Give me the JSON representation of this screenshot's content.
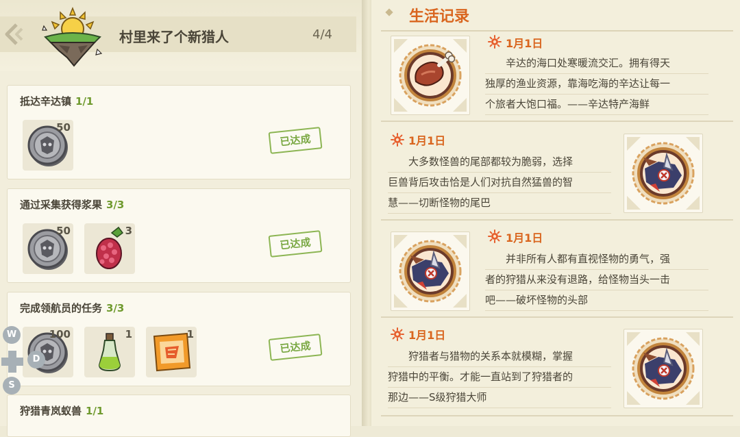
{
  "quest": {
    "title": "村里来了个新猎人",
    "progress": "4/4"
  },
  "tasks": [
    {
      "label": "抵达辛达镇",
      "count": "1/1",
      "status": "已达成",
      "rewards": [
        {
          "icon": "coin-icon",
          "qty": "50"
        }
      ]
    },
    {
      "label": "通过采集获得浆果",
      "count": "3/3",
      "status": "已达成",
      "rewards": [
        {
          "icon": "coin-icon",
          "qty": "50"
        },
        {
          "icon": "berry-icon",
          "qty": "3"
        }
      ]
    },
    {
      "label": "完成领航员的任务",
      "count": "3/3",
      "status": "已达成",
      "rewards": [
        {
          "icon": "coin-icon",
          "qty": "100"
        },
        {
          "icon": "potion-icon",
          "qty": "1"
        },
        {
          "icon": "map-scroll-icon",
          "qty": "1"
        }
      ]
    },
    {
      "label": "狩猎青岚蚁兽",
      "count": "1/1"
    }
  ],
  "controls": {
    "up": "W",
    "right": "D",
    "down": "S"
  },
  "log": {
    "title": "生活记录",
    "entries": [
      {
        "date": "1月1日",
        "icon": "meat-icon",
        "lines": [
          "辛达的海口处寒暖流交汇。拥有得天",
          "独厚的渔业资源，靠海吃海的辛达让每一",
          "个旅者大饱口福。——辛达特产海鲜"
        ]
      },
      {
        "date": "1月1日",
        "icon": "monster-tail-icon",
        "lines": [
          "大多数怪兽的尾部都较为脆弱，选择",
          "巨兽背后攻击恰是人们对抗自然猛兽的智",
          "慧——切断怪物的尾巴"
        ]
      },
      {
        "date": "1月1日",
        "icon": "monster-head-icon",
        "lines": [
          "并非所有人都有直视怪物的勇气，强",
          "者的狩猎从来没有退路，给怪物当头一击",
          "吧——破坏怪物的头部"
        ]
      },
      {
        "date": "1月1日",
        "icon": "monster-hunter-icon",
        "lines": [
          "狩猎者与猎物的关系本就模糊，掌握",
          "狩猎中的平衡。才能一直站到了狩猎者的",
          "那边——S级狩猎大师"
        ]
      }
    ]
  },
  "colors": {
    "accent": "#d9651e",
    "success": "#7aa843",
    "count_green": "#6f9a2e"
  }
}
